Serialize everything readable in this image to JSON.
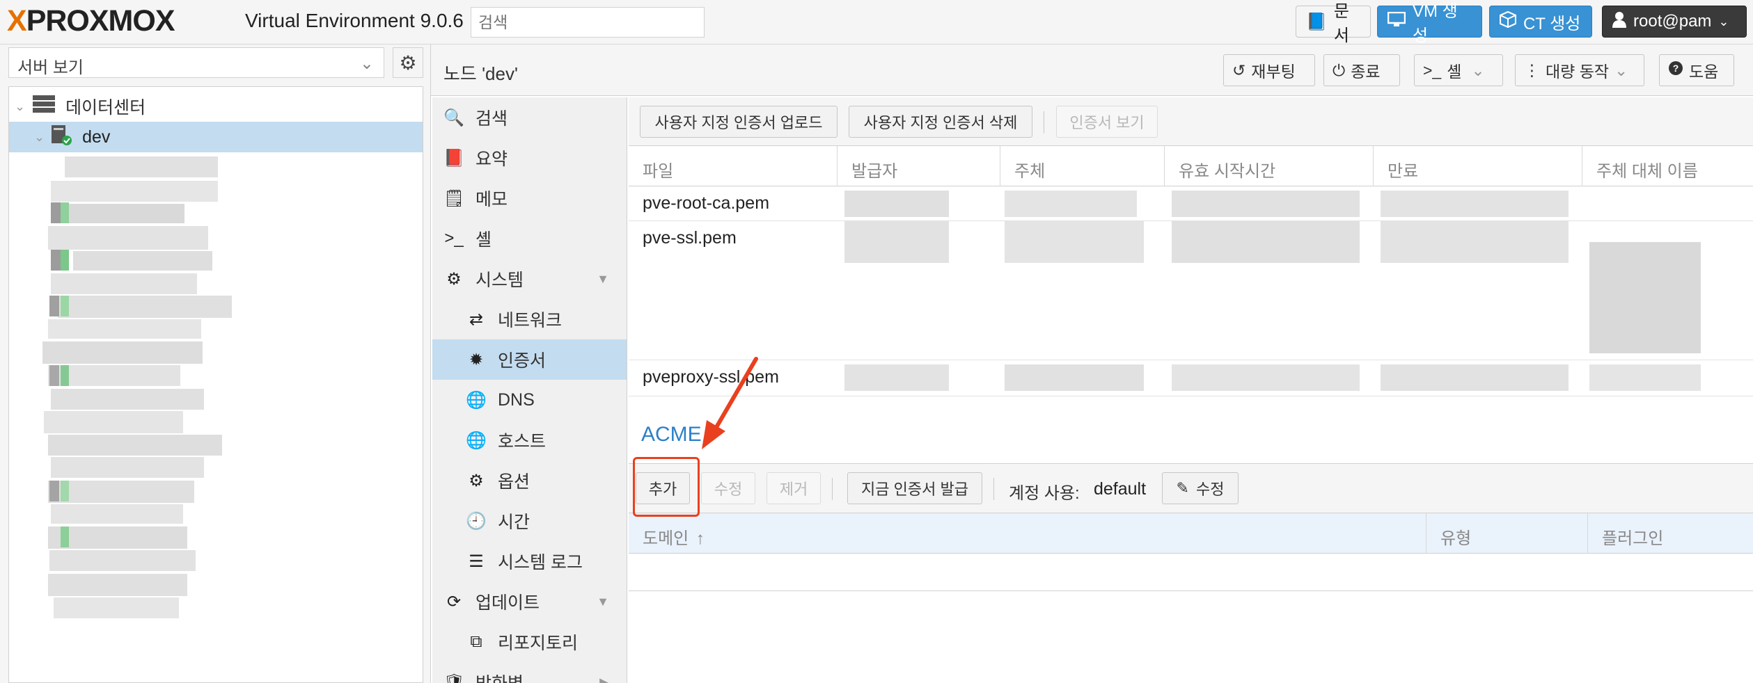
{
  "header": {
    "logo_text": "PROXMOX",
    "version": "Virtual Environment 9.0.6",
    "search_placeholder": "검색",
    "docs_label": "문서",
    "create_vm_label": "VM 생성",
    "create_ct_label": "CT 생성",
    "user_label": "root@pam"
  },
  "sidebar": {
    "view_label": "서버 보기",
    "tree": [
      {
        "label": "데이터센터",
        "icon": "datacenter-icon"
      },
      {
        "label": "dev",
        "icon": "node-online-icon"
      }
    ]
  },
  "content": {
    "title": "노드 'dev'",
    "toolbar": {
      "reboot": "재부팅",
      "shutdown": "종료",
      "shell": "셸",
      "bulk": "대량 동작",
      "help": "도움"
    }
  },
  "nav": [
    {
      "label": "검색",
      "icon": "search-icon"
    },
    {
      "label": "요약",
      "icon": "book-icon"
    },
    {
      "label": "메모",
      "icon": "note-icon"
    },
    {
      "label": "셸",
      "icon": "terminal-icon"
    },
    {
      "label": "시스템",
      "icon": "cogs-icon"
    },
    {
      "label": "네트워크",
      "icon": "exchange-icon"
    },
    {
      "label": "인증서",
      "icon": "certificate-icon"
    },
    {
      "label": "DNS",
      "icon": "globe-icon"
    },
    {
      "label": "호스트",
      "icon": "globe-icon"
    },
    {
      "label": "옵션",
      "icon": "gear-icon"
    },
    {
      "label": "시간",
      "icon": "clock-icon"
    },
    {
      "label": "시스템 로그",
      "icon": "list-icon"
    },
    {
      "label": "업데이트",
      "icon": "refresh-icon"
    },
    {
      "label": "리포지토리",
      "icon": "copy-icon"
    },
    {
      "label": "방화벽",
      "icon": "shield-icon"
    }
  ],
  "certificates": {
    "upload_label": "사용자 지정 인증서 업로드",
    "delete_label": "사용자 지정 인증서 삭제",
    "view_label": "인증서 보기",
    "columns": [
      "파일",
      "발급자",
      "주체",
      "유효 시작시간",
      "만료",
      "주체 대체 이름"
    ],
    "files": [
      "pve-root-ca.pem",
      "pve-ssl.pem",
      "pveproxy-ssl.pem"
    ]
  },
  "acme": {
    "title": "ACME",
    "add_label": "추가",
    "edit_label": "수정",
    "remove_label": "제거",
    "order_label": "지금 인증서 발급",
    "account_label": "계정 사용:",
    "account_value": "default",
    "account_edit_label": "수정",
    "columns": [
      "도메인",
      "유형",
      "플러그인"
    ]
  },
  "colors": {
    "brand_orange": "#e57000",
    "primary_blue": "#3892d4",
    "selection": "#c3dcf0",
    "annotation_red": "#e9401f"
  }
}
